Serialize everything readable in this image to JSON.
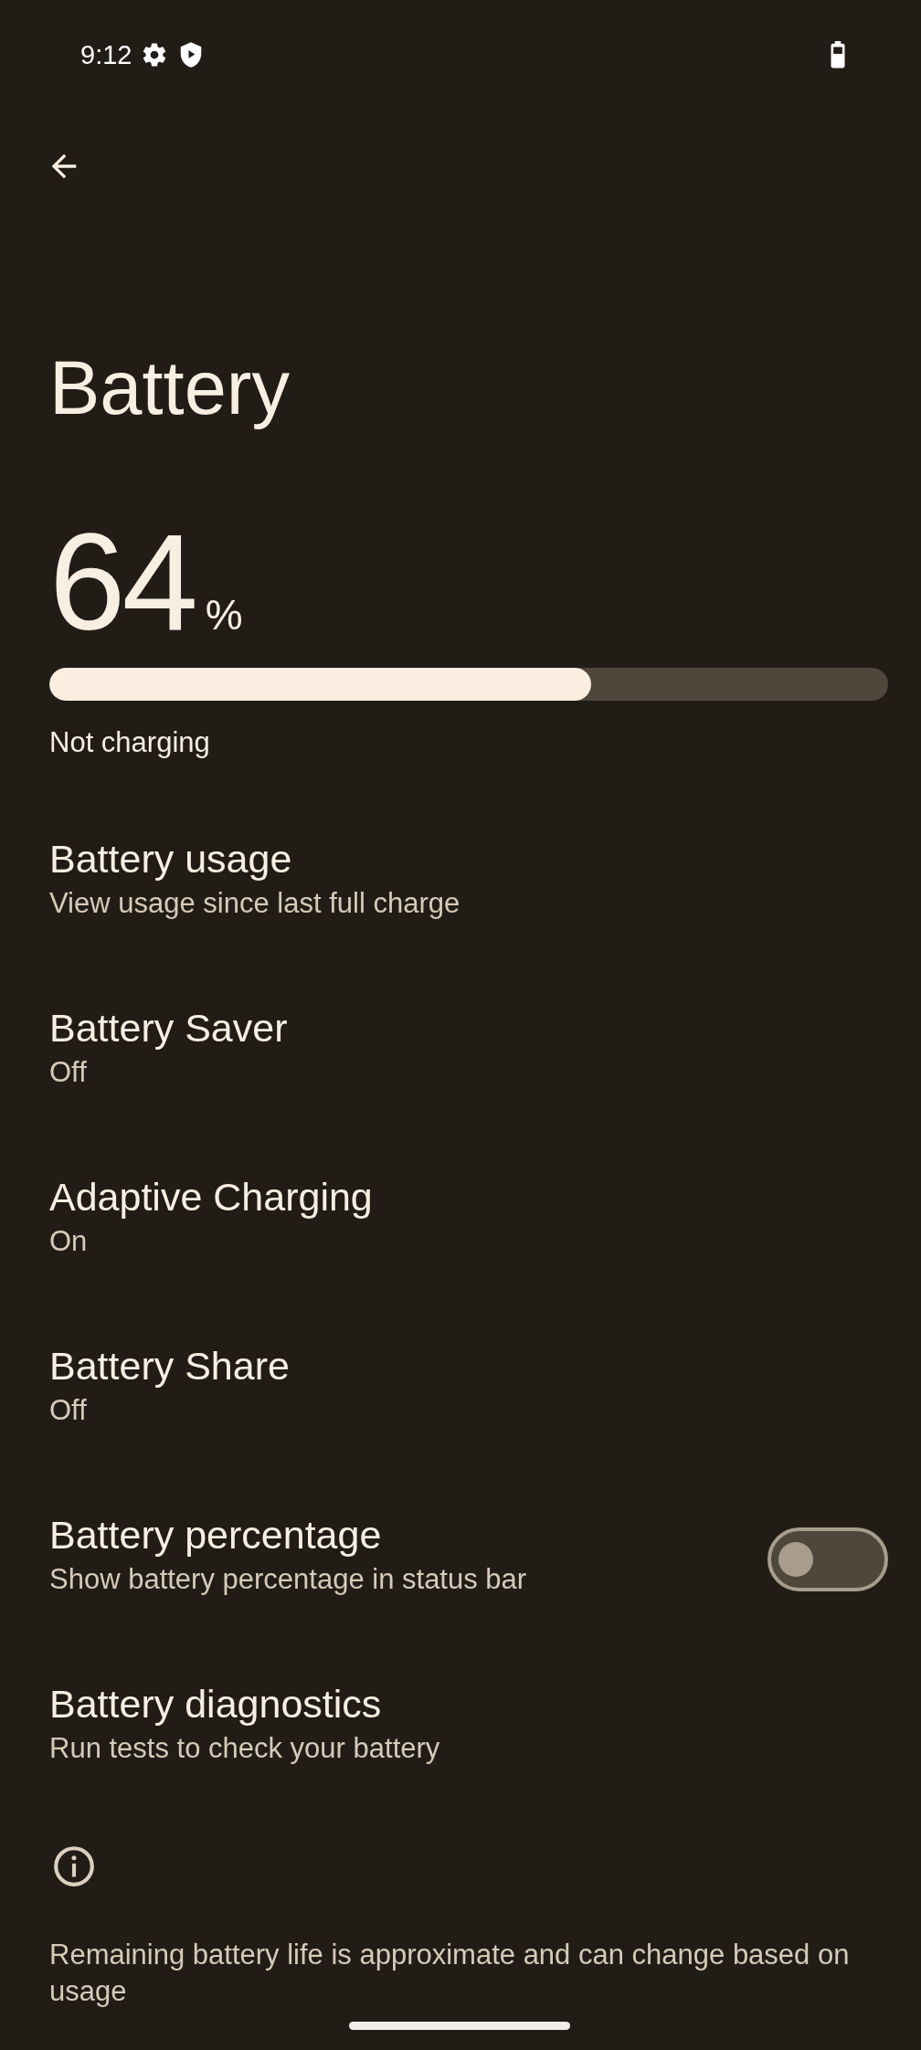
{
  "status_bar": {
    "time": "9:12"
  },
  "title": "Battery",
  "battery": {
    "percent": "64",
    "unit": "%",
    "level": 0.646,
    "status": "Not charging"
  },
  "items": [
    {
      "kind": "link",
      "title": "Battery usage",
      "summary": "View usage since last full charge"
    },
    {
      "kind": "link",
      "title": "Battery Saver",
      "summary": "Off"
    },
    {
      "kind": "link",
      "title": "Adaptive Charging",
      "summary": "On"
    },
    {
      "kind": "link",
      "title": "Battery Share",
      "summary": "Off"
    },
    {
      "kind": "toggle",
      "title": "Battery percentage",
      "summary": "Show battery percentage in status bar",
      "checked": false
    },
    {
      "kind": "link",
      "title": "Battery diagnostics",
      "summary": "Run tests to check your battery"
    }
  ],
  "footer": "Remaining battery life is approximate and can change based on usage"
}
